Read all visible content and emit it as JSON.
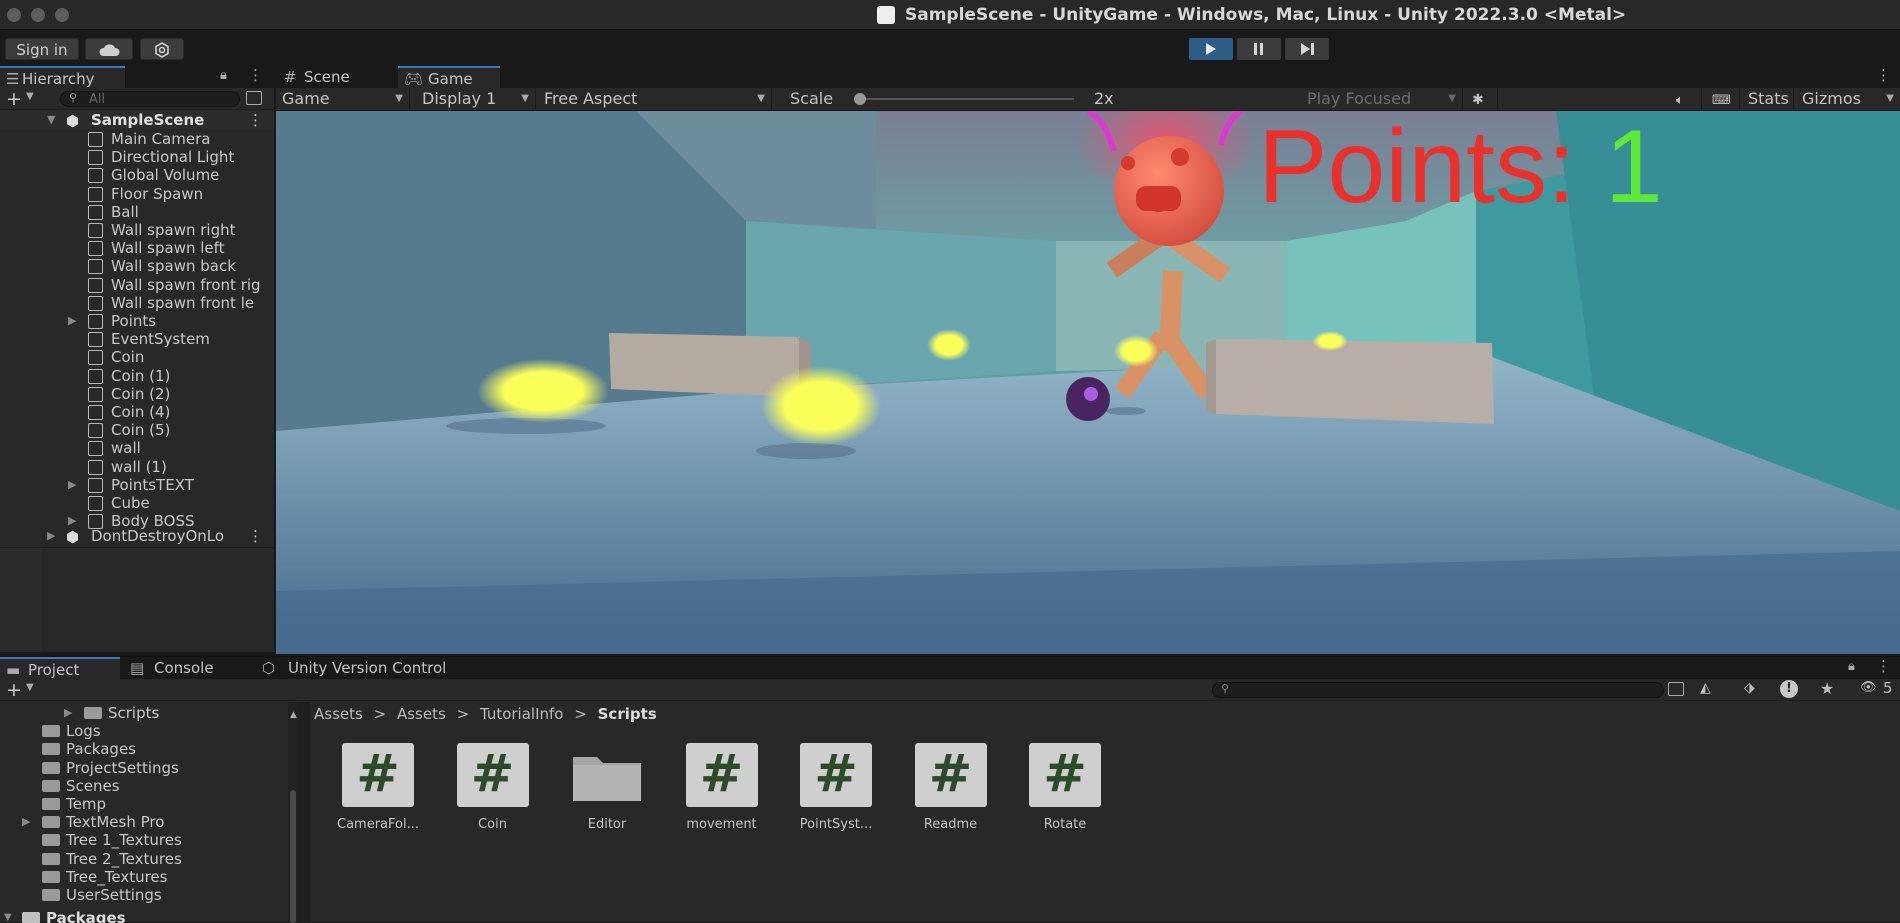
{
  "window": {
    "title": "SampleScene - UnityGame - Windows, Mac, Linux - Unity 2022.3.0 <Metal>"
  },
  "toolbar": {
    "sign_in": "Sign in"
  },
  "hierarchy": {
    "tab": "Hierarchy",
    "search_placeholder": "All",
    "scene": "SampleScene",
    "items": [
      "Main Camera",
      "Directional Light",
      "Global Volume",
      "Floor Spawn",
      "Ball",
      "Wall spawn right",
      "Wall spawn left",
      "Wall spawn back",
      "Wall spawn front rig",
      "Wall spawn front le",
      "Points",
      "EventSystem",
      "Coin",
      "Coin (1)",
      "Coin (2)",
      "Coin (4)",
      "Coin (5)",
      "wall",
      "wall (1)",
      "PointsTEXT",
      "Cube",
      "Body BOSS"
    ],
    "dont_destroy": "DontDestroyOnLo"
  },
  "gameview": {
    "tabs": [
      "Scene",
      "Game"
    ],
    "display_mode": "Game",
    "display": "Display 1",
    "aspect": "Free Aspect",
    "scale_label": "Scale",
    "scale_value": "2x",
    "play_focused": "Play Focused",
    "stats": "Stats",
    "gizmos": "Gizmos",
    "points_label": "Points:",
    "points_value": "1"
  },
  "project": {
    "tabs": [
      "Project",
      "Console",
      "Unity Version Control"
    ],
    "folders": [
      "Scripts",
      "Logs",
      "Packages",
      "ProjectSettings",
      "Scenes",
      "Temp",
      "TextMesh Pro",
      "Tree 1_Textures",
      "Tree 2_Textures",
      "Tree_Textures",
      "UserSettings"
    ],
    "packages_root": "Packages",
    "breadcrumb": [
      "Assets",
      "Assets",
      "TutorialInfo",
      "Scripts"
    ],
    "assets": [
      "CameraFol...",
      "Coin",
      "Editor",
      "movement",
      "PointSyst...",
      "Readme",
      "Rotate"
    ],
    "hidden_count": "5"
  },
  "colors": {
    "accent": "#3a79bb",
    "points_label": "#e8312b",
    "points_value": "#5ee83a",
    "coin": "#fbff5a"
  }
}
